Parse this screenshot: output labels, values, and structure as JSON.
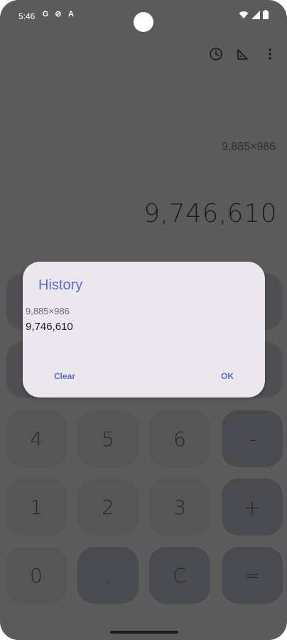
{
  "status_bar": {
    "time": "5:46",
    "left_icons": [
      "G",
      "⊘",
      "A"
    ]
  },
  "display": {
    "expression": "9,885×986",
    "result": "9,746,610"
  },
  "keypad": {
    "row3": [
      "4",
      "5",
      "6",
      "-"
    ],
    "row4": [
      "1",
      "2",
      "3",
      "+"
    ],
    "row5": [
      "0",
      ".",
      "C",
      "="
    ]
  },
  "dialog": {
    "title": "History",
    "history_expression": "9,885×986",
    "history_result": "9,746,610",
    "clear_label": "Clear",
    "ok_label": "OK"
  },
  "colors": {
    "scrim": "#5b5b5b",
    "dialog_bg": "#ece6ee",
    "accent": "#5d6ec7"
  }
}
